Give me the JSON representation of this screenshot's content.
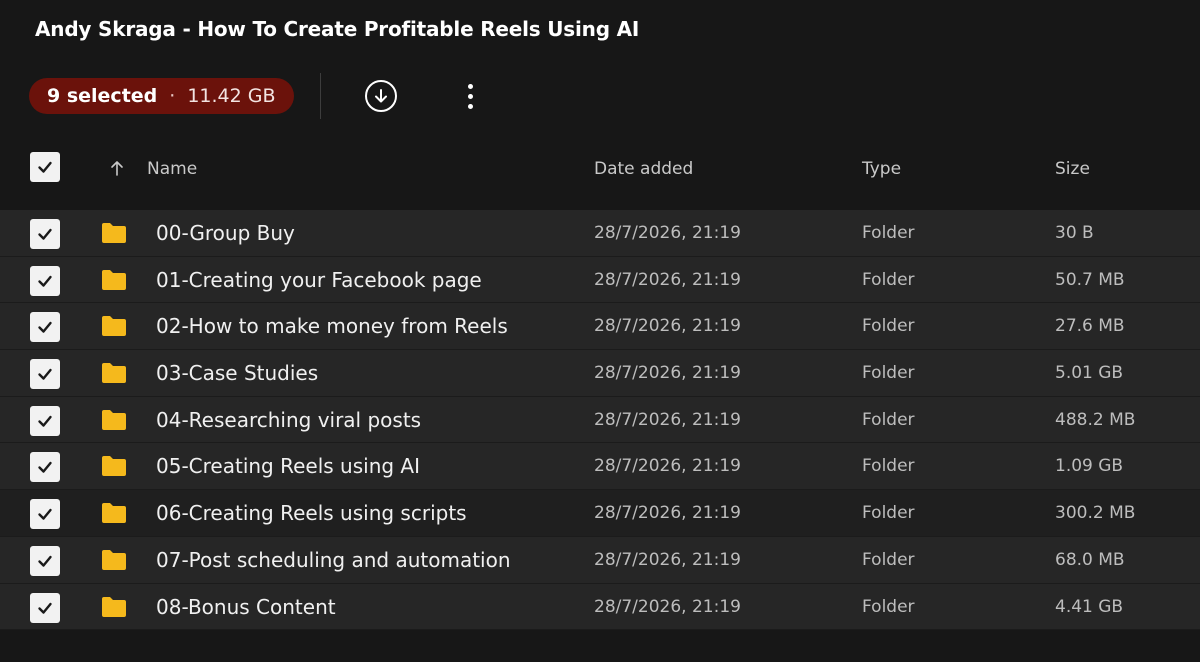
{
  "title": "Andy Skraga - How To Create Profitable Reels Using AI",
  "toolbar": {
    "selected_count": "9 selected",
    "separator": "·",
    "selected_size": "11.42 GB",
    "download_icon": "download-circle-icon",
    "more_icon": "more-vertical-icon"
  },
  "colors": {
    "background": "#171717",
    "selection_pill": "#6b120b",
    "folder": "#f5b91c",
    "row": "#262626"
  },
  "table": {
    "columns": {
      "name": "Name",
      "date": "Date added",
      "type": "Type",
      "size": "Size"
    },
    "sort_icon": "arrow-up-icon",
    "all_checked": true,
    "rows": [
      {
        "name": "00-Group Buy",
        "date": "28/7/2026, 21:19",
        "type": "Folder",
        "size": "30 B",
        "checked": true
      },
      {
        "name": "01-Creating your Facebook page",
        "date": "28/7/2026, 21:19",
        "type": "Folder",
        "size": "50.7 MB",
        "checked": true
      },
      {
        "name": "02-How to make money from Reels",
        "date": "28/7/2026, 21:19",
        "type": "Folder",
        "size": "27.6 MB",
        "checked": true
      },
      {
        "name": "03-Case Studies",
        "date": "28/7/2026, 21:19",
        "type": "Folder",
        "size": "5.01 GB",
        "checked": true
      },
      {
        "name": "04-Researching viral posts",
        "date": "28/7/2026, 21:19",
        "type": "Folder",
        "size": "488.2 MB",
        "checked": true
      },
      {
        "name": "05-Creating Reels using AI",
        "date": "28/7/2026, 21:19",
        "type": "Folder",
        "size": "1.09 GB",
        "checked": true
      },
      {
        "name": "06-Creating Reels using scripts",
        "date": "28/7/2026, 21:19",
        "type": "Folder",
        "size": "300.2 MB",
        "checked": true
      },
      {
        "name": "07-Post scheduling and automation",
        "date": "28/7/2026, 21:19",
        "type": "Folder",
        "size": "68.0 MB",
        "checked": true
      },
      {
        "name": "08-Bonus Content",
        "date": "28/7/2026, 21:19",
        "type": "Folder",
        "size": "4.41 GB",
        "checked": true
      }
    ]
  }
}
